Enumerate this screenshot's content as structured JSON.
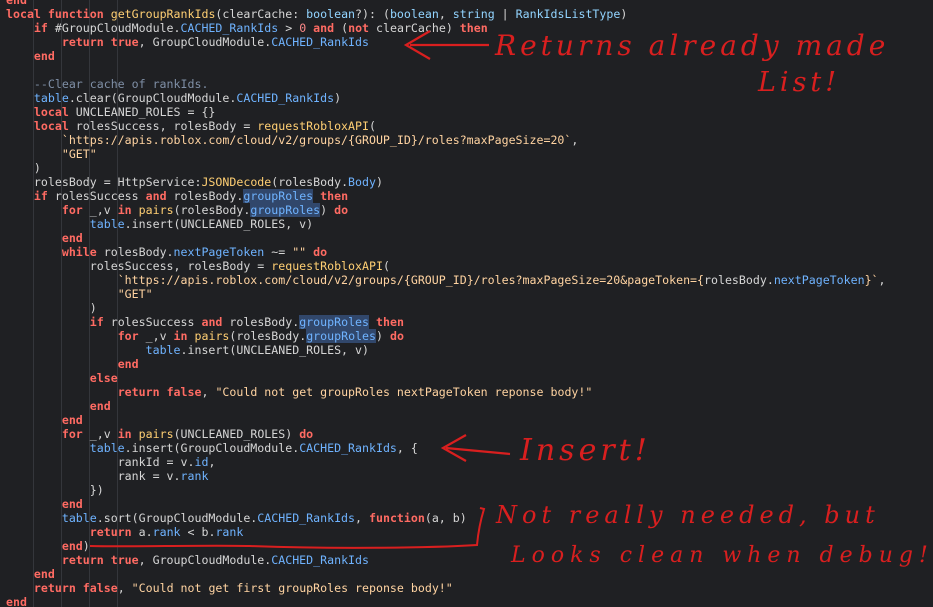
{
  "editor": {
    "lines": [
      {
        "tokens": [
          {
            "t": "end",
            "c": "kw"
          }
        ]
      },
      {
        "tokens": [
          {
            "t": "local",
            "c": "kw"
          },
          {
            "t": " "
          },
          {
            "t": "function",
            "c": "kw"
          },
          {
            "t": " "
          },
          {
            "t": "getGroupRankIds",
            "c": "fn"
          },
          {
            "t": "(clearCache: ",
            "c": "plain"
          },
          {
            "t": "boolean",
            "c": "type"
          },
          {
            "t": "?): (",
            "c": "plain"
          },
          {
            "t": "boolean",
            "c": "type"
          },
          {
            "t": ", ",
            "c": "plain"
          },
          {
            "t": "string",
            "c": "type"
          },
          {
            "t": " | ",
            "c": "plain"
          },
          {
            "t": "RankIdsListType",
            "c": "type"
          },
          {
            "t": ")",
            "c": "plain"
          }
        ]
      },
      {
        "tokens": [
          {
            "t": "    "
          },
          {
            "t": "if",
            "c": "kw"
          },
          {
            "t": " #GroupCloudModule.",
            "c": "plain"
          },
          {
            "t": "CACHED_RankIds",
            "c": "prop"
          },
          {
            "t": " > ",
            "c": "plain"
          },
          {
            "t": "0",
            "c": "num"
          },
          {
            "t": " ",
            "c": "plain"
          },
          {
            "t": "and",
            "c": "kw"
          },
          {
            "t": " (",
            "c": "plain"
          },
          {
            "t": "not",
            "c": "kw"
          },
          {
            "t": " clearCache) ",
            "c": "plain"
          },
          {
            "t": "then",
            "c": "kw"
          }
        ]
      },
      {
        "tokens": [
          {
            "t": "        "
          },
          {
            "t": "return",
            "c": "kw"
          },
          {
            "t": " ",
            "c": "plain"
          },
          {
            "t": "true",
            "c": "kw"
          },
          {
            "t": ", GroupCloudModule.",
            "c": "plain"
          },
          {
            "t": "CACHED_RankIds",
            "c": "prop"
          }
        ]
      },
      {
        "tokens": [
          {
            "t": "    "
          },
          {
            "t": "end",
            "c": "kw"
          }
        ]
      },
      {
        "tokens": []
      },
      {
        "tokens": [
          {
            "t": "    "
          },
          {
            "t": "--Clear cache of rankIds.",
            "c": "com"
          }
        ]
      },
      {
        "tokens": [
          {
            "t": "    "
          },
          {
            "t": "table",
            "c": "prop"
          },
          {
            "t": ".clear(GroupCloudModule.",
            "c": "plain"
          },
          {
            "t": "CACHED_RankIds",
            "c": "prop"
          },
          {
            "t": ")",
            "c": "plain"
          }
        ]
      },
      {
        "tokens": [
          {
            "t": "    "
          },
          {
            "t": "local",
            "c": "kw"
          },
          {
            "t": " UNCLEANED_ROLES = {}",
            "c": "plain"
          }
        ]
      },
      {
        "tokens": [
          {
            "t": "    "
          },
          {
            "t": "local",
            "c": "kw"
          },
          {
            "t": " rolesSuccess, rolesBody = ",
            "c": "plain"
          },
          {
            "t": "requestRobloxAPI",
            "c": "fn"
          },
          {
            "t": "(",
            "c": "plain"
          }
        ]
      },
      {
        "tokens": [
          {
            "t": "        "
          },
          {
            "t": "`https://apis.roblox.com/cloud/v2/groups/{GROUP_ID}/roles?maxPageSize=20`",
            "c": "str"
          },
          {
            "t": ",",
            "c": "plain"
          }
        ]
      },
      {
        "tokens": [
          {
            "t": "        "
          },
          {
            "t": "\"GET\"",
            "c": "str"
          }
        ]
      },
      {
        "tokens": [
          {
            "t": "    "
          },
          {
            "t": ")",
            "c": "plain"
          }
        ]
      },
      {
        "tokens": [
          {
            "t": "    "
          },
          {
            "t": "rolesBody = HttpService:",
            "c": "plain"
          },
          {
            "t": "JSONDecode",
            "c": "fn"
          },
          {
            "t": "(rolesBody.",
            "c": "plain"
          },
          {
            "t": "Body",
            "c": "prop"
          },
          {
            "t": ")",
            "c": "plain"
          }
        ]
      },
      {
        "tokens": [
          {
            "t": "    "
          },
          {
            "t": "if",
            "c": "kw"
          },
          {
            "t": " rolesSuccess ",
            "c": "plain"
          },
          {
            "t": "and",
            "c": "kw"
          },
          {
            "t": " rolesBody.",
            "c": "plain"
          },
          {
            "t": "groupRoles",
            "c": "hl"
          },
          {
            "t": " ",
            "c": "plain"
          },
          {
            "t": "then",
            "c": "kw"
          }
        ]
      },
      {
        "tokens": [
          {
            "t": "        "
          },
          {
            "t": "for",
            "c": "kw"
          },
          {
            "t": " _,v ",
            "c": "plain"
          },
          {
            "t": "in",
            "c": "kw"
          },
          {
            "t": " ",
            "c": "plain"
          },
          {
            "t": "pairs",
            "c": "fn"
          },
          {
            "t": "(rolesBody.",
            "c": "plain"
          },
          {
            "t": "groupRoles",
            "c": "hl"
          },
          {
            "t": ") ",
            "c": "plain"
          },
          {
            "t": "do",
            "c": "kw"
          }
        ]
      },
      {
        "tokens": [
          {
            "t": "            "
          },
          {
            "t": "table",
            "c": "prop"
          },
          {
            "t": ".insert(UNCLEANED_ROLES, v)",
            "c": "plain"
          }
        ]
      },
      {
        "tokens": [
          {
            "t": "        "
          },
          {
            "t": "end",
            "c": "kw"
          }
        ]
      },
      {
        "tokens": [
          {
            "t": "        "
          },
          {
            "t": "while",
            "c": "kw"
          },
          {
            "t": " rolesBody.",
            "c": "plain"
          },
          {
            "t": "nextPageToken",
            "c": "prop"
          },
          {
            "t": " ~= ",
            "c": "plain"
          },
          {
            "t": "\"\"",
            "c": "str"
          },
          {
            "t": " ",
            "c": "plain"
          },
          {
            "t": "do",
            "c": "kw"
          }
        ]
      },
      {
        "tokens": [
          {
            "t": "            "
          },
          {
            "t": "rolesSuccess, rolesBody = ",
            "c": "plain"
          },
          {
            "t": "requestRobloxAPI",
            "c": "fn"
          },
          {
            "t": "(",
            "c": "plain"
          }
        ]
      },
      {
        "tokens": [
          {
            "t": "                "
          },
          {
            "t": "`https://apis.roblox.com/cloud/v2/groups/{GROUP_ID}/roles?maxPageSize=20&pageToken={",
            "c": "str"
          },
          {
            "t": "rolesBody.",
            "c": "plain"
          },
          {
            "t": "nextPageToken",
            "c": "prop"
          },
          {
            "t": "}`",
            "c": "str"
          },
          {
            "t": ",",
            "c": "plain"
          }
        ]
      },
      {
        "tokens": [
          {
            "t": "                "
          },
          {
            "t": "\"GET\"",
            "c": "str"
          }
        ]
      },
      {
        "tokens": [
          {
            "t": "            "
          },
          {
            "t": ")",
            "c": "plain"
          }
        ]
      },
      {
        "tokens": [
          {
            "t": "            "
          },
          {
            "t": "if",
            "c": "kw"
          },
          {
            "t": " rolesSuccess ",
            "c": "plain"
          },
          {
            "t": "and",
            "c": "kw"
          },
          {
            "t": " rolesBody.",
            "c": "plain"
          },
          {
            "t": "groupRoles",
            "c": "hl"
          },
          {
            "t": " ",
            "c": "plain"
          },
          {
            "t": "then",
            "c": "kw"
          }
        ]
      },
      {
        "tokens": [
          {
            "t": "                "
          },
          {
            "t": "for",
            "c": "kw"
          },
          {
            "t": " _,v ",
            "c": "plain"
          },
          {
            "t": "in",
            "c": "kw"
          },
          {
            "t": " ",
            "c": "plain"
          },
          {
            "t": "pairs",
            "c": "fn"
          },
          {
            "t": "(rolesBody.",
            "c": "plain"
          },
          {
            "t": "groupRoles",
            "c": "hl"
          },
          {
            "t": ") ",
            "c": "plain"
          },
          {
            "t": "do",
            "c": "kw"
          }
        ]
      },
      {
        "tokens": [
          {
            "t": "                    "
          },
          {
            "t": "table",
            "c": "prop"
          },
          {
            "t": ".insert(UNCLEANED_ROLES, v)",
            "c": "plain"
          }
        ]
      },
      {
        "tokens": [
          {
            "t": "                "
          },
          {
            "t": "end",
            "c": "kw"
          }
        ]
      },
      {
        "tokens": [
          {
            "t": "            "
          },
          {
            "t": "else",
            "c": "kw"
          }
        ]
      },
      {
        "tokens": [
          {
            "t": "                "
          },
          {
            "t": "return",
            "c": "kw"
          },
          {
            "t": " ",
            "c": "plain"
          },
          {
            "t": "false",
            "c": "kw"
          },
          {
            "t": ", ",
            "c": "plain"
          },
          {
            "t": "\"Could not get groupRoles nextPageToken reponse body!\"",
            "c": "str"
          }
        ]
      },
      {
        "tokens": [
          {
            "t": "            "
          },
          {
            "t": "end",
            "c": "kw"
          }
        ]
      },
      {
        "tokens": [
          {
            "t": "        "
          },
          {
            "t": "end",
            "c": "kw"
          }
        ]
      },
      {
        "tokens": [
          {
            "t": "        "
          },
          {
            "t": "for",
            "c": "kw"
          },
          {
            "t": " _,v ",
            "c": "plain"
          },
          {
            "t": "in",
            "c": "kw"
          },
          {
            "t": " ",
            "c": "plain"
          },
          {
            "t": "pairs",
            "c": "fn"
          },
          {
            "t": "(UNCLEANED_ROLES) ",
            "c": "plain"
          },
          {
            "t": "do",
            "c": "kw"
          }
        ]
      },
      {
        "tokens": [
          {
            "t": "            "
          },
          {
            "t": "table",
            "c": "prop"
          },
          {
            "t": ".insert(GroupCloudModule.",
            "c": "plain"
          },
          {
            "t": "CACHED_RankIds",
            "c": "prop"
          },
          {
            "t": ", {",
            "c": "plain"
          }
        ]
      },
      {
        "tokens": [
          {
            "t": "                "
          },
          {
            "t": "rankId = v.",
            "c": "plain"
          },
          {
            "t": "id",
            "c": "prop"
          },
          {
            "t": ",",
            "c": "plain"
          }
        ]
      },
      {
        "tokens": [
          {
            "t": "                "
          },
          {
            "t": "rank = v.",
            "c": "plain"
          },
          {
            "t": "rank",
            "c": "prop"
          }
        ]
      },
      {
        "tokens": [
          {
            "t": "            "
          },
          {
            "t": "})",
            "c": "plain"
          }
        ]
      },
      {
        "tokens": [
          {
            "t": "        "
          },
          {
            "t": "end",
            "c": "kw"
          }
        ]
      },
      {
        "tokens": [
          {
            "t": "        "
          },
          {
            "t": "table",
            "c": "prop"
          },
          {
            "t": ".sort(GroupCloudModule.",
            "c": "plain"
          },
          {
            "t": "CACHED_RankIds",
            "c": "prop"
          },
          {
            "t": ", ",
            "c": "plain"
          },
          {
            "t": "function",
            "c": "kw"
          },
          {
            "t": "(a, b)",
            "c": "plain"
          }
        ]
      },
      {
        "tokens": [
          {
            "t": "            "
          },
          {
            "t": "return",
            "c": "kw"
          },
          {
            "t": " a.",
            "c": "plain"
          },
          {
            "t": "rank",
            "c": "prop"
          },
          {
            "t": " < b.",
            "c": "plain"
          },
          {
            "t": "rank",
            "c": "prop"
          }
        ]
      },
      {
        "tokens": [
          {
            "t": "        "
          },
          {
            "t": "end",
            "c": "kw"
          },
          {
            "t": ")",
            "c": "plain"
          }
        ]
      },
      {
        "tokens": [
          {
            "t": "        "
          },
          {
            "t": "return",
            "c": "kw"
          },
          {
            "t": " ",
            "c": "plain"
          },
          {
            "t": "true",
            "c": "kw"
          },
          {
            "t": ", GroupCloudModule.",
            "c": "plain"
          },
          {
            "t": "CACHED_RankIds",
            "c": "prop"
          }
        ]
      },
      {
        "tokens": [
          {
            "t": "    "
          },
          {
            "t": "end",
            "c": "kw"
          }
        ]
      },
      {
        "tokens": [
          {
            "t": "    "
          },
          {
            "t": "return",
            "c": "kw"
          },
          {
            "t": " ",
            "c": "plain"
          },
          {
            "t": "false",
            "c": "kw"
          },
          {
            "t": ", ",
            "c": "plain"
          },
          {
            "t": "\"Could not get first groupRoles reponse body!\"",
            "c": "str"
          }
        ]
      },
      {
        "tokens": [
          {
            "t": "end",
            "c": "kw"
          }
        ]
      }
    ]
  },
  "annotations": {
    "returns_list": "Returns already made",
    "list": "List!",
    "insert": "Insert!",
    "not_needed": "Not really needed, but",
    "looks_clean": "Looks clean when debug!"
  },
  "colors": {
    "background": "#1f2023",
    "keyword": "#ff6b63",
    "string": "#ffd3a1",
    "property": "#6fb3ff",
    "function": "#ffcf73",
    "annotation_ink": "#d91f1f"
  }
}
